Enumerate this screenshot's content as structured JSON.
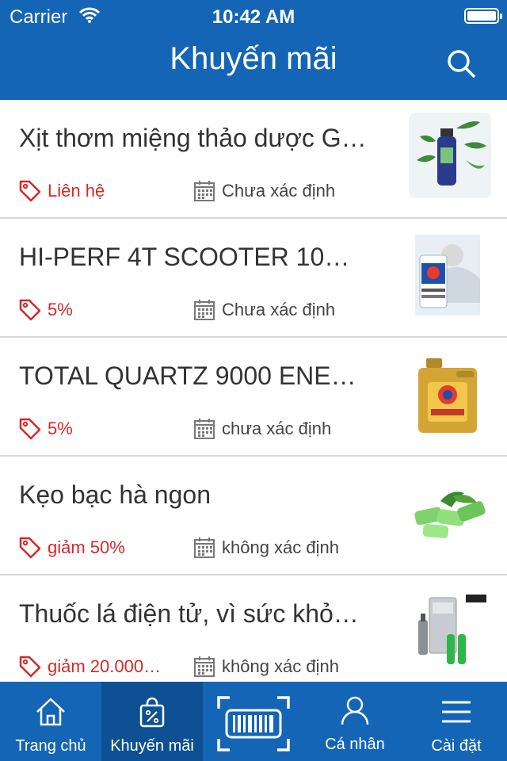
{
  "status": {
    "carrier": "Carrier",
    "time": "10:42 AM"
  },
  "header": {
    "title": "Khuyến mãi"
  },
  "promotions": [
    {
      "name": "Xịt thơm miệng thảo dược G…",
      "discount": "Liên hệ",
      "date": "Chưa xác định",
      "thumbnail": "mouth-spray-image"
    },
    {
      "name": "HI-PERF 4T SCOOTER 10…",
      "discount": "5%",
      "date": "Chưa xác định",
      "thumbnail": "scooter-oil-image"
    },
    {
      "name": "TOTAL QUARTZ 9000 ENE…",
      "discount": "5%",
      "date": "chưa xác định",
      "thumbnail": "motor-oil-can-image"
    },
    {
      "name": "Kẹo bạc hà ngon",
      "discount": "giảm 50%",
      "date": "không xác định",
      "thumbnail": "mint-gum-image"
    },
    {
      "name": "Thuốc lá điện tử, vì sức khỏ…",
      "discount": "giảm 20.000…",
      "date": "không xác định",
      "thumbnail": "e-cigarette-image"
    }
  ],
  "tabs": [
    {
      "label": "Trang chủ",
      "icon": "home-icon"
    },
    {
      "label": "Khuyến mãi",
      "icon": "shopping-bag-icon"
    },
    {
      "label": "",
      "icon": "barcode-scan-icon"
    },
    {
      "label": "Cá nhân",
      "icon": "user-icon"
    },
    {
      "label": "Cài đặt",
      "icon": "menu-icon"
    }
  ],
  "colors": {
    "brand": "#1565b6",
    "active_tab": "#0d5094",
    "discount": "#d62828"
  }
}
